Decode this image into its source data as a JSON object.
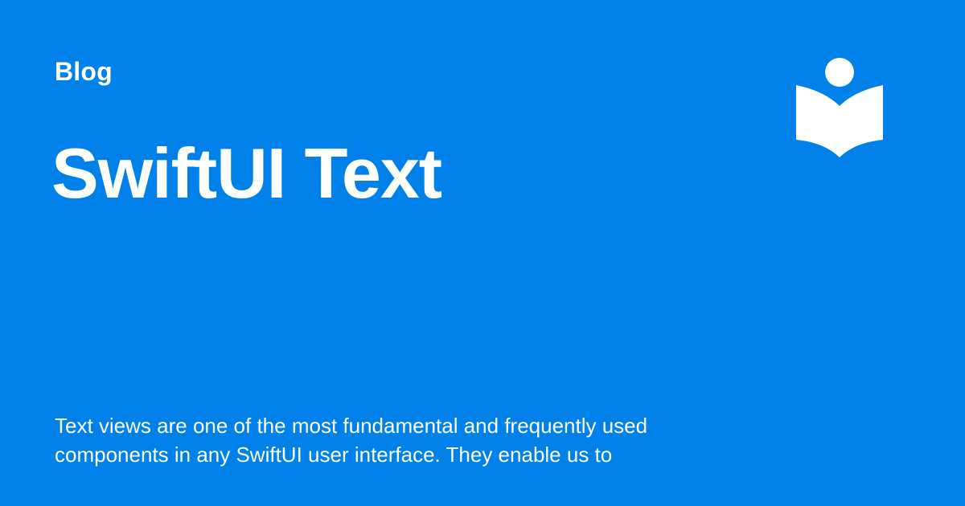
{
  "card": {
    "category": "Blog",
    "title": "SwiftUI Text",
    "excerpt": "Text views are one of the most fundamental and frequently used components in any SwiftUI user interface. They enable us to"
  },
  "logo": {
    "icon": "reading-person-book-icon",
    "color": "#FFFFFF"
  },
  "colors": {
    "background": "#0081E9",
    "text": "#FFFFFF"
  }
}
